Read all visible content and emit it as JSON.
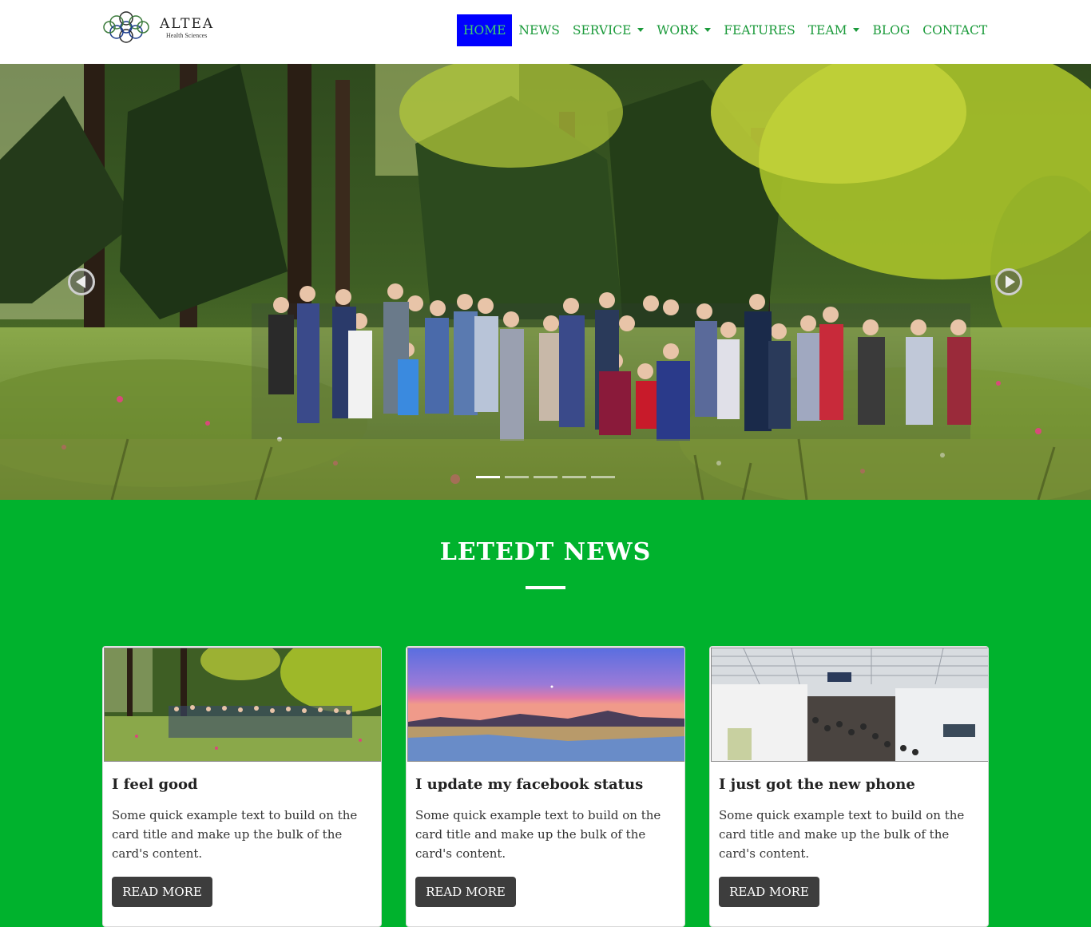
{
  "brand": {
    "name": "ALTEA",
    "tagline": "Health Sciences"
  },
  "nav": {
    "items": [
      {
        "label": "HOME",
        "active": true,
        "dropdown": false
      },
      {
        "label": "NEWS",
        "active": false,
        "dropdown": false
      },
      {
        "label": "SERVICE",
        "active": false,
        "dropdown": true
      },
      {
        "label": "WORK",
        "active": false,
        "dropdown": true
      },
      {
        "label": "FEATURES",
        "active": false,
        "dropdown": false
      },
      {
        "label": "TEAM",
        "active": false,
        "dropdown": true
      },
      {
        "label": "BLOG",
        "active": false,
        "dropdown": false
      },
      {
        "label": "CONTACT",
        "active": false,
        "dropdown": false
      }
    ]
  },
  "carousel": {
    "slide_count": 5,
    "active_index": 0,
    "prev_icon": "chevron-left-icon",
    "next_icon": "chevron-right-icon"
  },
  "news": {
    "title": "LETEDT NEWS",
    "cards": [
      {
        "title": "I feel good",
        "text": "Some quick example text to build on the card title and make up the bulk of the card's content.",
        "button": "READ MORE"
      },
      {
        "title": "I update my facebook status",
        "text": "Some quick example text to build on the card title and make up the bulk of the card's content.",
        "button": "READ MORE"
      },
      {
        "title": "I just got the new phone",
        "text": "Some quick example text to build on the card title and make up the bulk of the card's content.",
        "button": "READ MORE"
      }
    ]
  },
  "colors": {
    "nav_text": "#1a9a3a",
    "nav_active_bg": "#0000ff",
    "section_green": "#00b22d",
    "button_dark": "#3d3d3d"
  }
}
